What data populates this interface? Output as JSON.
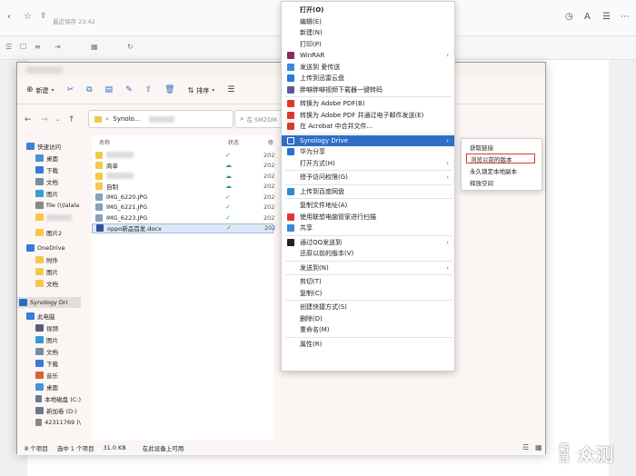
{
  "app": {
    "autosave_text": "最近保存 23:42"
  },
  "explorer": {
    "new_label": "新建",
    "sort_label": "排序",
    "address": {
      "sep": "«",
      "folder": "Synolo..."
    },
    "search_placeholder": "在 SMZDM",
    "columns": {
      "name": "名称",
      "status": "状态",
      "date": "修"
    },
    "sidebar": [
      {
        "label": "快速访问",
        "icon": "star-icon",
        "color": "#3b82d6"
      },
      {
        "label": "桌面",
        "icon": "desktop-icon",
        "color": "#4a90d9"
      },
      {
        "label": "下载",
        "icon": "download-icon",
        "color": "#3a7bd5"
      },
      {
        "label": "文档",
        "icon": "document-icon",
        "color": "#7a8aa0"
      },
      {
        "label": "图片",
        "icon": "pictures-icon",
        "color": "#3a9ad5"
      },
      {
        "label": "file (\\\\lalala",
        "icon": "network-drive-icon",
        "color": "#888888"
      },
      {
        "label": "",
        "icon": "folder-icon",
        "color": "#f4c84a"
      },
      {
        "label": "图片2",
        "icon": "folder-icon",
        "color": "#f4c84a"
      },
      {
        "label": "OneDrive",
        "icon": "cloud-icon",
        "color": "#2f7fd8"
      },
      {
        "label": "附件",
        "icon": "folder-icon",
        "color": "#f4c84a"
      },
      {
        "label": "图片",
        "icon": "folder-icon",
        "color": "#f4c84a"
      },
      {
        "label": "文档",
        "icon": "folder-icon",
        "color": "#f4c84a"
      },
      {
        "label": "Synology Dri",
        "icon": "synology-drive-icon",
        "color": "#2a6fbf"
      },
      {
        "label": "此电脑",
        "icon": "computer-icon",
        "color": "#3a7bd5"
      },
      {
        "label": "视频",
        "icon": "video-icon",
        "color": "#5a5a7a"
      },
      {
        "label": "图片",
        "icon": "pictures-icon",
        "color": "#3a9ad5"
      },
      {
        "label": "文档",
        "icon": "document-icon",
        "color": "#7a8aa0"
      },
      {
        "label": "下载",
        "icon": "download-icon",
        "color": "#3a7bd5"
      },
      {
        "label": "音乐",
        "icon": "music-icon",
        "color": "#d9603a"
      },
      {
        "label": "桌面",
        "icon": "desktop-icon",
        "color": "#4a90d9"
      },
      {
        "label": "本地磁盘 (C:)",
        "icon": "drive-icon",
        "color": "#6a7a8a"
      },
      {
        "label": "新加卷 (D:)",
        "icon": "drive-icon",
        "color": "#6a7a8a"
      },
      {
        "label": "42311769 (\\",
        "icon": "network-drive-icon",
        "color": "#888888"
      }
    ],
    "files": [
      {
        "name": "",
        "type": "folder",
        "status": "✓",
        "date": "202"
      },
      {
        "name": "商单",
        "type": "folder",
        "status": "☁",
        "date": "202"
      },
      {
        "name": "",
        "type": "folder",
        "status": "☁",
        "date": "202"
      },
      {
        "name": "自制",
        "type": "folder",
        "status": "☁",
        "date": "202"
      },
      {
        "name": "IMG_6220.JPG",
        "type": "image",
        "status": "✓",
        "date": "202"
      },
      {
        "name": "IMG_6221.JPG",
        "type": "image",
        "status": "✓",
        "date": "202"
      },
      {
        "name": "IMG_6223.JPG",
        "type": "image",
        "status": "✓",
        "date": "202"
      },
      {
        "name": "oppo新品首发.docx",
        "type": "word",
        "status": "✓",
        "date": "202",
        "selected": true
      }
    ],
    "status": {
      "count": "8 个项目",
      "selected": "选中 1 个项目",
      "size": "31.0 KB",
      "availability": "在此设备上可用"
    }
  },
  "context_menu": [
    {
      "label": "打开(O)",
      "bold": true
    },
    {
      "label": "编辑(E)"
    },
    {
      "label": "新建(N)"
    },
    {
      "label": "打印(P)"
    },
    {
      "label": "WinRAR",
      "icon": "winrar-icon",
      "color": "#8b2a5a",
      "arrow": true
    },
    {
      "label": "发送到 爱传送",
      "icon": "send-icon",
      "color": "#3a8ad5"
    },
    {
      "label": "上传到迅雷云盘",
      "icon": "thunder-icon",
      "color": "#2a7ad5"
    },
    {
      "label": "胖噼胖噼视频下载器一键转码",
      "icon": "video-icon",
      "color": "#5a5a9a"
    },
    {
      "sep": true
    },
    {
      "label": "转换为 Adobe PDF(B)",
      "icon": "pdf-icon",
      "color": "#d93a2b"
    },
    {
      "label": "转换为 Adobe PDF 并通过电子邮件发送(E)",
      "icon": "pdf-icon",
      "color": "#d93a2b"
    },
    {
      "label": "在 Acrobat 中合并文件...",
      "icon": "acrobat-icon",
      "color": "#d93a2b"
    },
    {
      "sep": true
    },
    {
      "label": "Synology Drive",
      "icon": "synology-drive-icon",
      "color": "#ffffff",
      "arrow": true,
      "highlight": true
    },
    {
      "label": "华为分享",
      "icon": "huawei-share-icon",
      "color": "#2a6fd5"
    },
    {
      "label": "打开方式(H)",
      "arrow": true
    },
    {
      "sep": true
    },
    {
      "label": "授予访问权限(G)",
      "arrow": true
    },
    {
      "sep": true
    },
    {
      "label": "上传到百度网盘",
      "icon": "baidu-cloud-icon",
      "color": "#2a8ad5"
    },
    {
      "sep": true
    },
    {
      "label": "复制文件地址(A)"
    },
    {
      "label": "使用联想电脑管家进行扫描",
      "icon": "lenovo-shield-icon",
      "color": "#d93a2b"
    },
    {
      "label": "共享",
      "icon": "share-icon",
      "color": "#3a8ad5"
    },
    {
      "sep": true
    },
    {
      "label": "通过QQ发送到",
      "icon": "qq-icon",
      "color": "#222222",
      "arrow": true
    },
    {
      "label": "还原以前的版本(V)"
    },
    {
      "sep": true
    },
    {
      "label": "发送到(N)",
      "arrow": true
    },
    {
      "sep": true
    },
    {
      "label": "剪切(T)"
    },
    {
      "label": "复制(C)"
    },
    {
      "sep": true
    },
    {
      "label": "创建快捷方式(S)"
    },
    {
      "label": "删除(D)"
    },
    {
      "label": "重命名(M)"
    },
    {
      "sep": true
    },
    {
      "label": "属性(R)"
    }
  ],
  "submenu": [
    {
      "label": "获取链接"
    },
    {
      "label": "浏览以前的版本",
      "boxed": true
    },
    {
      "label": "永久锁定本地副本"
    },
    {
      "label": "释放空间"
    }
  ],
  "watermark": {
    "logo_top": "新",
    "logo_bottom": "浪",
    "text": "众测"
  },
  "colors": {
    "highlight": "#2f6ec7",
    "annotation_box": "#d93a2b",
    "sync_ok": "#2a9d5c"
  }
}
